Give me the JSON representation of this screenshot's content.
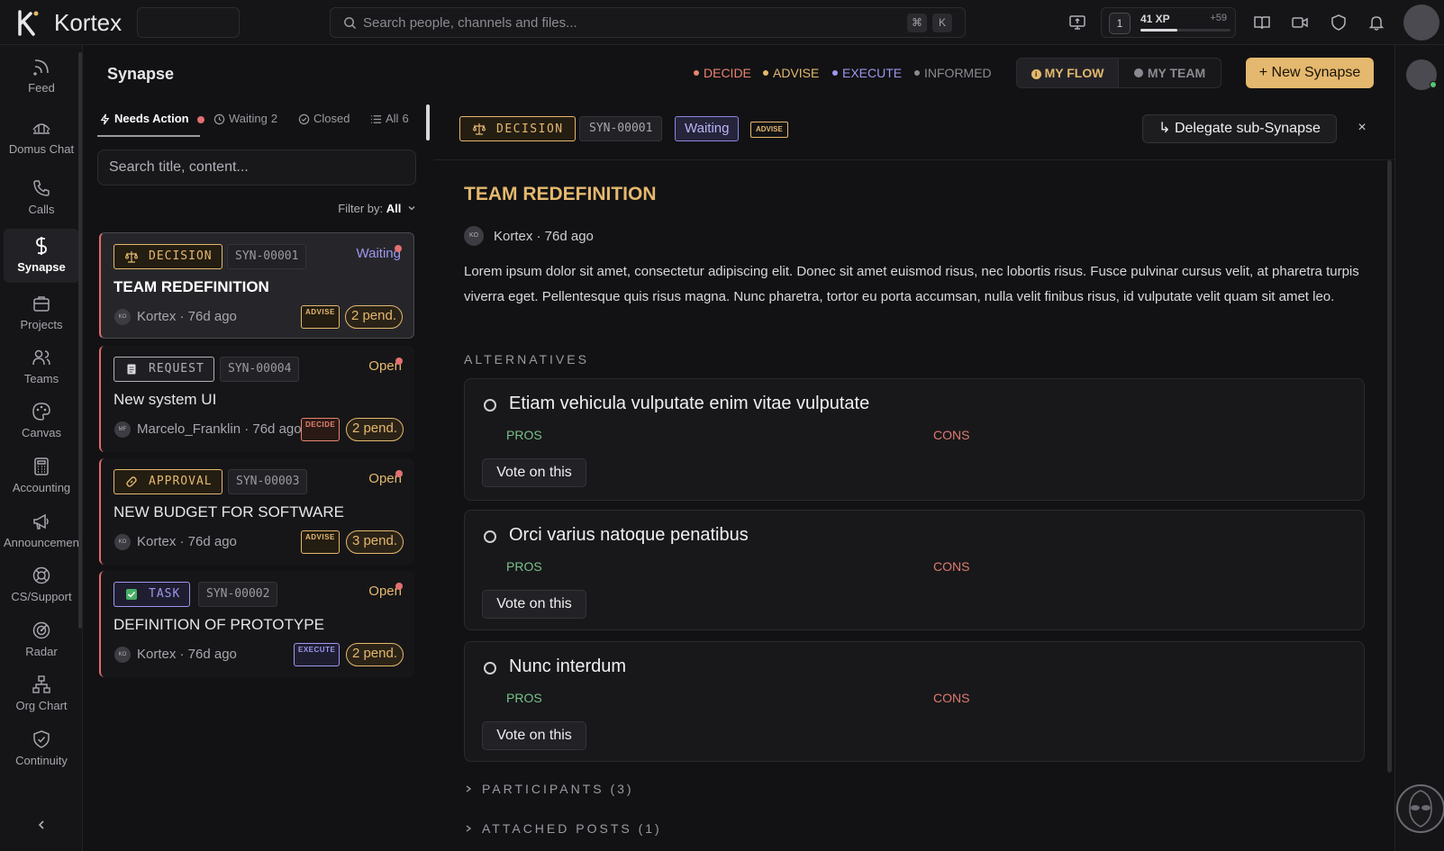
{
  "app": {
    "brand": "Kortex",
    "search_placeholder": "Search people, channels and files...",
    "kbd_cmd": "⌘",
    "kbd_k": "K",
    "level": "1",
    "xp_label": "41 XP",
    "xp_bonus": "+59",
    "xp_progress": 0.41
  },
  "nav": {
    "items": [
      {
        "label": "Feed",
        "icon": "rss-icon"
      },
      {
        "label": "Domus Chat",
        "icon": "domus-icon"
      },
      {
        "label": "Calls",
        "icon": "phone-icon"
      },
      {
        "label": "Synapse",
        "icon": "synapse-icon",
        "active": true
      },
      {
        "label": "Projects",
        "icon": "briefcase-icon"
      },
      {
        "label": "Teams",
        "icon": "users-icon"
      },
      {
        "label": "Canvas",
        "icon": "palette-icon"
      },
      {
        "label": "Accounting",
        "icon": "calculator-icon"
      },
      {
        "label": "Announcements",
        "icon": "megaphone-icon"
      },
      {
        "label": "CS/Support",
        "icon": "lifebuoy-icon"
      },
      {
        "label": "Radar",
        "icon": "radar-icon"
      },
      {
        "label": "Org Chart",
        "icon": "org-chart-icon"
      },
      {
        "label": "Continuity",
        "icon": "shield-check-icon"
      }
    ]
  },
  "header": {
    "title": "Synapse",
    "roles": [
      {
        "label": "DECIDE",
        "color": "#e8836f"
      },
      {
        "label": "ADVISE",
        "color": "#e4b86e"
      },
      {
        "label": "EXECUTE",
        "color": "#9d97ef"
      },
      {
        "label": "INFORMED",
        "color": "#8a8a92"
      }
    ],
    "my_flow": "MY FLOW",
    "my_team": "MY TEAM",
    "new_synapse": "+ New Synapse"
  },
  "list": {
    "tabs": [
      {
        "label": "Needs Action",
        "count": ""
      },
      {
        "label": "Waiting",
        "count": "2"
      },
      {
        "label": "Closed",
        "count": ""
      },
      {
        "label": "All",
        "count": "6"
      }
    ],
    "search_placeholder": "Search title, content...",
    "filter_label": "Filter by:",
    "filter_value": "All",
    "cards": [
      {
        "type": "DECISION",
        "id": "SYN-00001",
        "status": "Waiting",
        "title": "TEAM REDEFINITION",
        "author_initials": "KO",
        "meta": "Kortex · 76d ago",
        "role": "ADVISE",
        "pending": "2 pend."
      },
      {
        "type": "REQUEST",
        "id": "SYN-00004",
        "status": "Open",
        "title": "New system UI",
        "author_initials": "MF",
        "meta": "Marcelo_Franklin · 76d ago",
        "role": "DECIDE",
        "pending": "2 pend."
      },
      {
        "type": "APPROVAL",
        "id": "SYN-00003",
        "status": "Open",
        "title": "NEW BUDGET FOR SOFTWARE",
        "author_initials": "KO",
        "meta": "Kortex · 76d ago",
        "role": "ADVISE",
        "pending": "3 pend."
      },
      {
        "type": "TASK",
        "id": "SYN-00002",
        "status": "Open",
        "title": "DEFINITION OF PROTOTYPE",
        "author_initials": "KO",
        "meta": "Kortex · 76d ago",
        "role": "EXECUTE",
        "pending": "2 pend."
      }
    ]
  },
  "detail": {
    "type": "DECISION",
    "id": "SYN-00001",
    "status": "Waiting",
    "role": "ADVISE",
    "delegate": "↳ Delegate sub-Synapse",
    "close": "×",
    "title": "TEAM REDEFINITION",
    "author_initials": "KO",
    "author": "Kortex · 76d ago",
    "body": "Lorem ipsum dolor sit amet, consectetur adipiscing elit. Donec sit amet euismod risus, nec lobortis risus. Fusce pulvinar cursus velit, at pharetra turpis viverra eget. Pellentesque quis risus magna. Nunc pharetra, tortor eu porta accumsan, nulla velit finibus risus, id vulputate velit quam sit amet leo.",
    "alternatives_label": "ALTERNATIVES",
    "alternatives": [
      {
        "title": "Etiam vehicula vulputate enim vitae vulputate",
        "pros": "PROS",
        "cons": "CONS",
        "vote": "Vote on this"
      },
      {
        "title": "Orci varius natoque penatibus",
        "pros": "PROS",
        "cons": "CONS",
        "vote": "Vote on this"
      },
      {
        "title": "Nunc interdum",
        "pros": "PROS",
        "cons": "CONS",
        "vote": "Vote on this"
      }
    ],
    "participants_label": "PARTICIPANTS (3)",
    "attached_label": "ATTACHED POSTS (1)"
  }
}
